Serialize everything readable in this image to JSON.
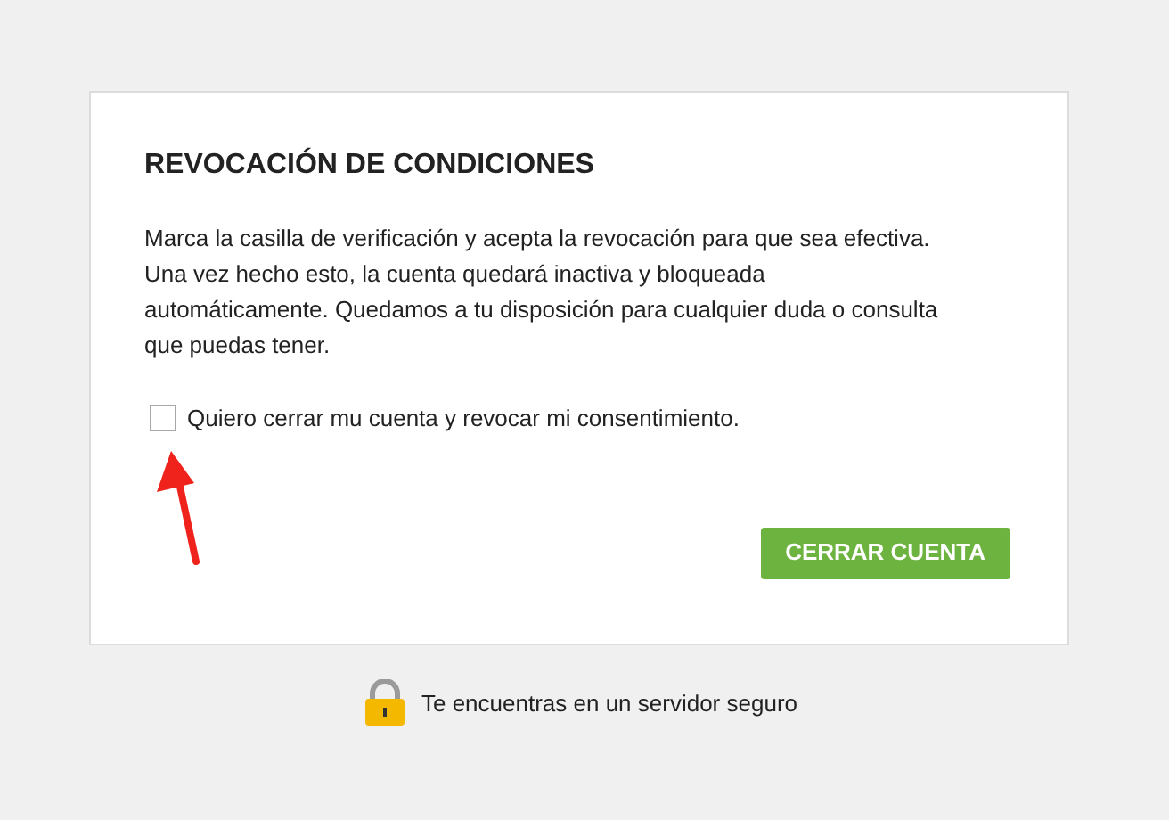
{
  "card": {
    "title": "REVOCACIÓN DE CONDICIONES",
    "message": "Marca la casilla de verificación y acepta la revocación para que sea efectiva. Una vez hecho esto, la cuenta quedará inactiva y bloqueada automáticamente. Quedamos a tu disposición para cualquier duda o consulta que puedas tener.",
    "consent": {
      "label": "Quiero cerrar mu cuenta y revocar mi consentimiento.",
      "checked": false
    },
    "button": "CERRAR CUENTA"
  },
  "footer": {
    "secure_note": "Te encuentras en un servidor seguro"
  }
}
